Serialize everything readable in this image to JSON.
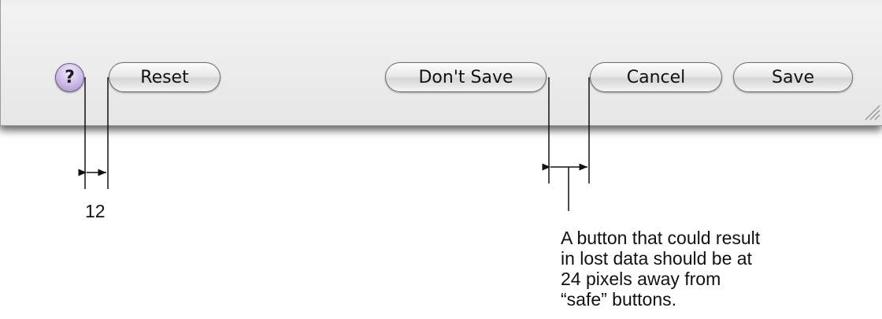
{
  "dialog": {
    "help_button": {
      "glyph": "?",
      "icon": "help-icon"
    },
    "buttons": {
      "reset": "Reset",
      "dont_save": "Don't Save",
      "cancel": "Cancel",
      "save": "Save"
    }
  },
  "annotations": {
    "help_to_reset_spacing": "12",
    "callout_lines": [
      "A button that could result",
      "in lost data should be at",
      "24 pixels away from",
      "“safe” buttons."
    ]
  },
  "colors": {
    "window_background": "#ececec",
    "help_button_tint": "#cdb8e7",
    "button_border": "#6e6e6e",
    "annotation_line": "#111111"
  }
}
